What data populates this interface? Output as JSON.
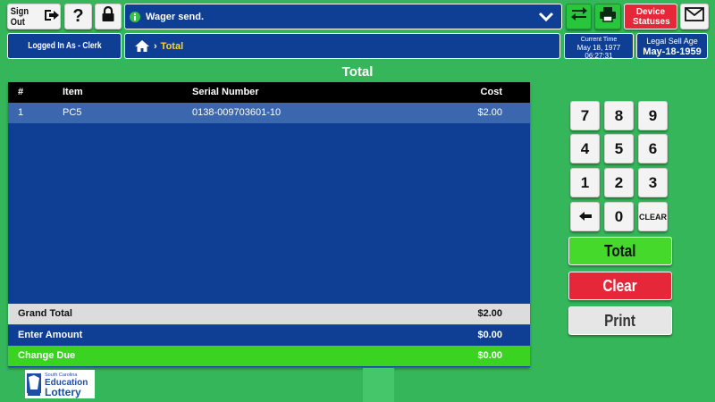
{
  "topbar": {
    "signout_label": "Sign Out",
    "help_label": "?",
    "message": "Wager send.",
    "device_statuses_label": "Device Statuses"
  },
  "status": {
    "logged_in": "Logged In As - Clerk",
    "breadcrumb_current": "Total",
    "current_time_label": "Current Time",
    "current_date": "May 18, 1977",
    "current_time": "06:27:31",
    "legal_age_label": "Legal Sell Age",
    "legal_age_date": "May-18-1959"
  },
  "page_title": "Total",
  "table": {
    "headers": {
      "num": "#",
      "item": "Item",
      "serial": "Serial Number",
      "cost": "Cost"
    },
    "rows": [
      {
        "num": "1",
        "item": "PC5",
        "serial": "0138-009703601-10",
        "cost": "$2.00"
      }
    ],
    "grand_total_label": "Grand Total",
    "grand_total_value": "$2.00",
    "enter_amount_label": "Enter Amount",
    "enter_amount_value": "$0.00",
    "change_due_label": "Change Due",
    "change_due_value": "$0.00"
  },
  "keypad": {
    "k7": "7",
    "k8": "8",
    "k9": "9",
    "k4": "4",
    "k5": "5",
    "k6": "6",
    "k1": "1",
    "k2": "2",
    "k3": "3",
    "k0": "0",
    "clear": "CLEAR"
  },
  "actions": {
    "total": "Total",
    "clear": "Clear",
    "print": "Print"
  },
  "logo": {
    "line1": "South Carolina",
    "line2": "Education",
    "line3": "Lottery"
  },
  "colors": {
    "background": "#35b65a",
    "panel_blue": "#0e3f94",
    "row_selected": "#3a67ad",
    "accent_red": "#e62639",
    "accent_green": "#44d92b",
    "breadcrumb_yellow": "#ffd21f"
  }
}
